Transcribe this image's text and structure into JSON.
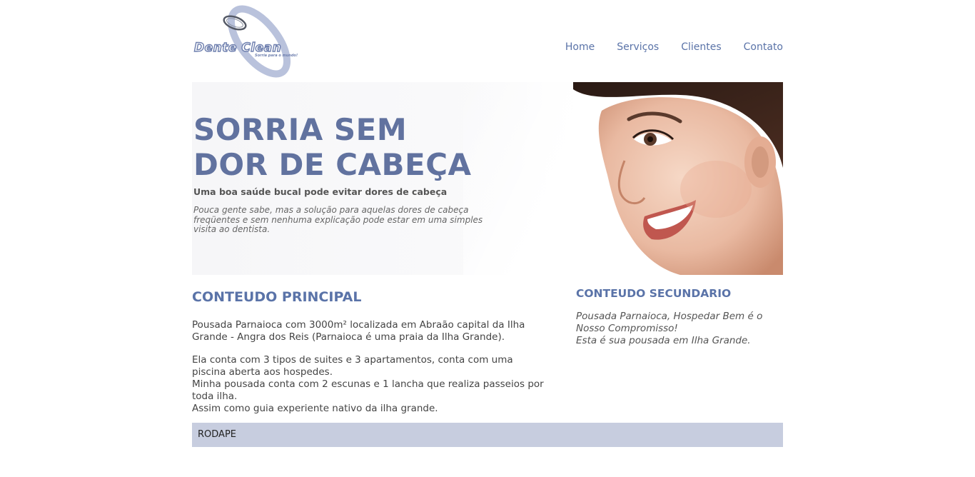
{
  "logo": {
    "text": "Dente Clean",
    "tagline": "Sorria para o mundo!"
  },
  "nav": {
    "items": [
      "Home",
      "Serviços",
      "Clientes",
      "Contato"
    ]
  },
  "banner": {
    "headline_line1": "SORRIA SEM",
    "headline_line2": "DOR DE CABEÇA",
    "subtitle": "Uma boa saúde bucal pode evitar dores de cabeça",
    "description": "Pouca gente sabe, mas a solução para aquelas dores de cabeça freqüentes e sem nenhuma explicação pode estar em uma simples visita ao dentista."
  },
  "main": {
    "title": "CONTEUDO PRINCIPAL",
    "paragraph1": "Pousada Parnaioca com 3000m² localizada em Abraão capital da Ilha Grande - Angra dos Reis (Parnaioca é uma praia da Ilha Grande).",
    "line2": "Ela conta com 3 tipos de suites e 3 apartamentos, conta com uma piscina aberta aos hospedes.",
    "line3": "Minha pousada conta com 2 escunas e 1 lancha que realiza passeios por toda ilha.",
    "line4": "Assim como guia experiente nativo da ilha grande."
  },
  "side": {
    "title": "CONTEUDO SECUNDARIO",
    "line1": "Pousada Parnaioca, Hospedar Bem é o Nosso Compromisso!",
    "line2": "Esta é sua pousada em Ilha Grande."
  },
  "footer": {
    "label": "RODAPE"
  },
  "colors": {
    "accent": "#5a73a8",
    "headline": "#61729f",
    "footer_bg": "#c7cddf"
  }
}
